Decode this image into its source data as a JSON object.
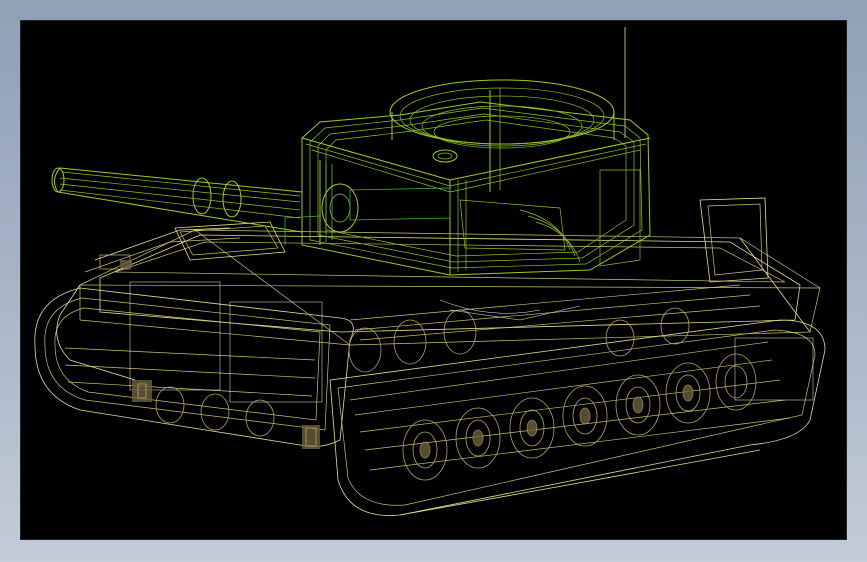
{
  "window": {
    "background_gradient": [
      "#8f9fb5",
      "#c3ccd8"
    ],
    "viewport_background": "#000000"
  },
  "model": {
    "render_style": "wireframe",
    "colors": {
      "hull": "#e6e08a",
      "turret": "#9acd1e",
      "mesh": "#f2f2e8",
      "wheels": "#b8a26a"
    }
  }
}
